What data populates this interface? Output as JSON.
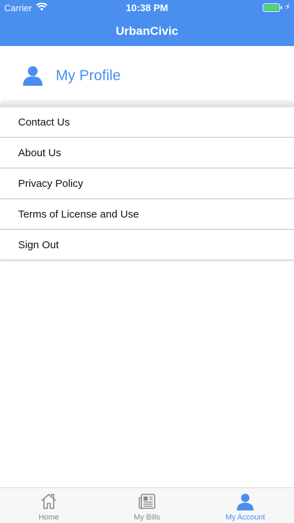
{
  "status_bar": {
    "carrier": "Carrier",
    "time": "10:38 PM"
  },
  "header": {
    "title": "UrbanCivic"
  },
  "profile": {
    "label": "My Profile",
    "icon": "user-icon"
  },
  "menu": {
    "items": [
      {
        "label": "Contact Us"
      },
      {
        "label": "About Us"
      },
      {
        "label": "Privacy Policy"
      },
      {
        "label": "Terms of License and Use"
      },
      {
        "label": "Sign Out"
      }
    ]
  },
  "tabs": [
    {
      "label": "Home",
      "icon": "home-icon",
      "active": false
    },
    {
      "label": "My Bills",
      "icon": "newspaper-icon",
      "active": false
    },
    {
      "label": "My Account",
      "icon": "user-icon",
      "active": true
    }
  ],
  "colors": {
    "accent": "#4a8ef0",
    "inactive": "#8a8a8a"
  }
}
